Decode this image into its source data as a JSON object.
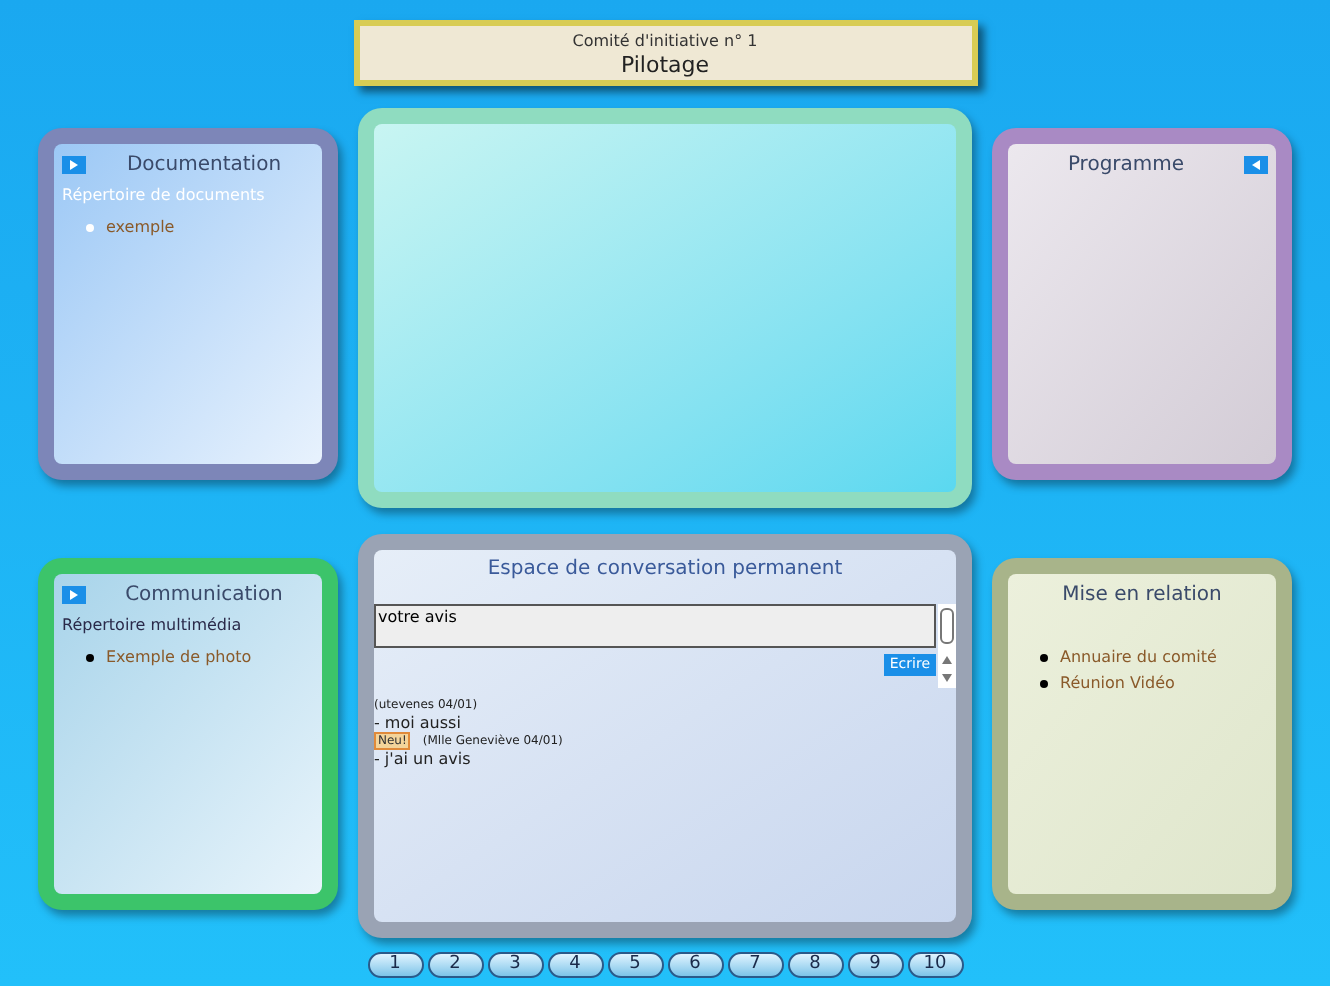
{
  "header": {
    "subtitle": "Comité d'initiative n° 1",
    "title": "Pilotage"
  },
  "panels": [
    {
      "kind": "links",
      "title": "Documentation",
      "color": "#7d86b8",
      "toggle_before": true,
      "section": "Répertoire de documents",
      "light_bullets": true,
      "items": [
        "exemple"
      ]
    },
    {
      "kind": "blank",
      "color": "#8fdcc0"
    },
    {
      "kind": "links",
      "title": "Programme",
      "color": "#a98ac4",
      "toggle_after": true
    },
    {
      "kind": "links",
      "title": "Communication",
      "color": "#3cc46a",
      "toggle_before": true,
      "section": "Répertoire multimédia",
      "light_bullets": false,
      "items": [
        "Exemple de photo"
      ]
    },
    {
      "kind": "chat",
      "title": "Espace de conversation permanent",
      "color": "#9aa3b4",
      "input": {
        "value": "votre avis"
      },
      "button": "Ecrire",
      "messages": [
        {
          "kind": "meta",
          "text": "(utevenes 04/01)"
        },
        {
          "kind": "message",
          "text": "- moi aussi"
        },
        {
          "kind": "meta",
          "badge": "Neu!",
          "text": "(Mlle Geneviève 04/01)"
        },
        {
          "kind": "message",
          "text": "- j'ai un avis"
        }
      ]
    },
    {
      "kind": "links",
      "title": "Mise en relation",
      "color": "#a8b48a",
      "light_bullets": false,
      "items": [
        "Annuaire du comité",
        "Réunion Vidéo"
      ]
    }
  ],
  "pages": [
    "1",
    "2",
    "3",
    "4",
    "5",
    "6",
    "7",
    "8",
    "9",
    "10"
  ]
}
